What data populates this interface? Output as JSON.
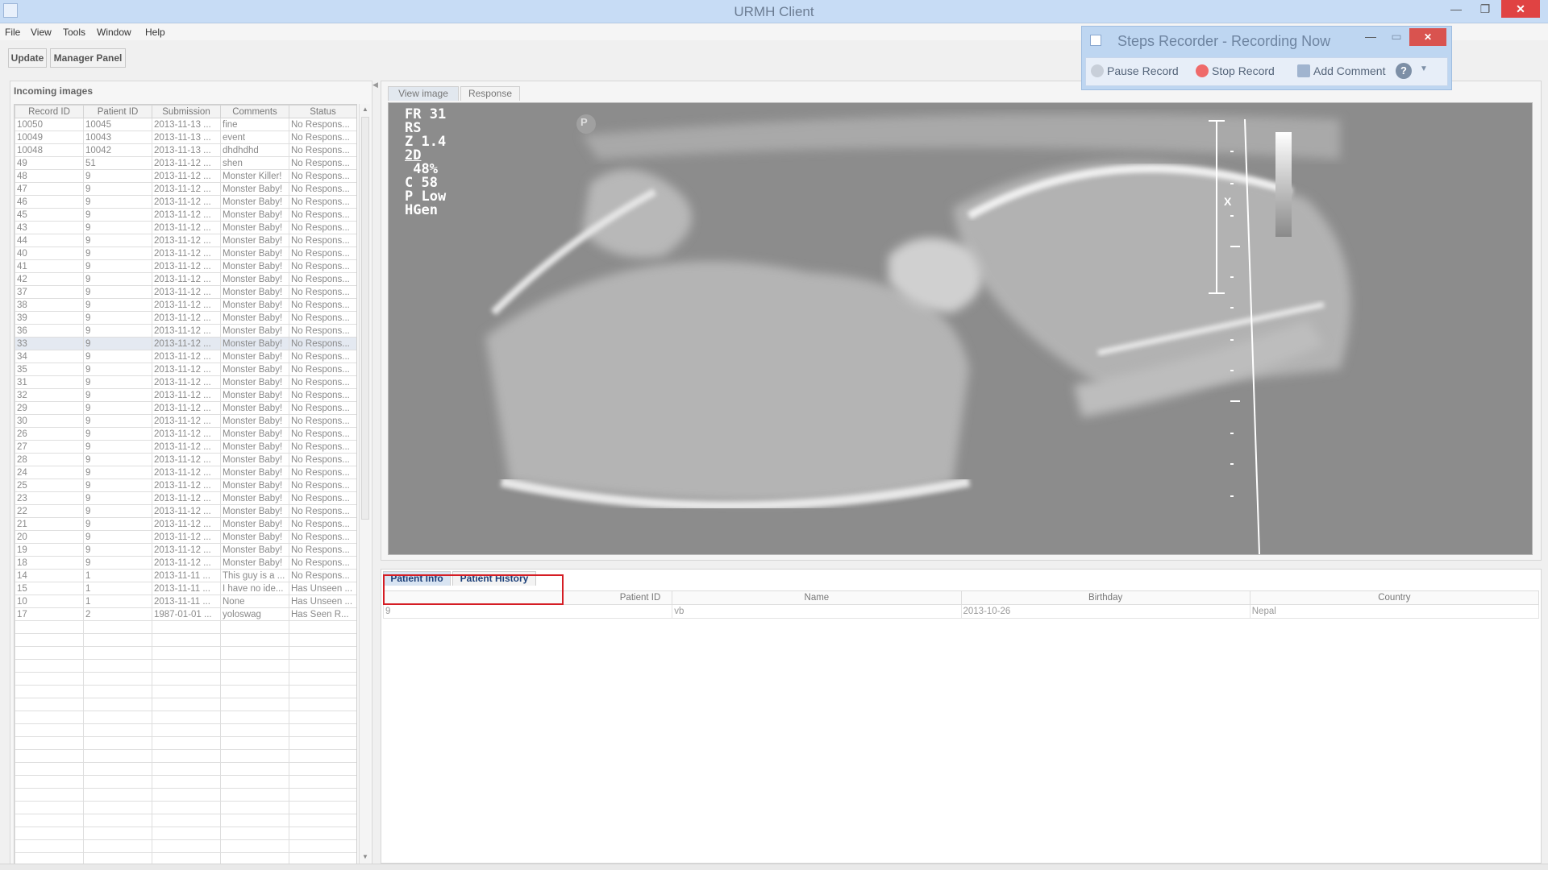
{
  "window": {
    "title": "URMH Client",
    "minimize": "—",
    "maximize": "❐",
    "close": "✕"
  },
  "menu": [
    {
      "label": "File"
    },
    {
      "label": "View"
    },
    {
      "label": "Tools"
    },
    {
      "label": "Window"
    },
    {
      "label": "Help"
    }
  ],
  "toolbar": {
    "update_label": "Update",
    "manager_label": "Manager Panel"
  },
  "incoming": {
    "header": "Incoming images",
    "columns": [
      "Record ID",
      "Patient ID",
      "Submission",
      "Comments",
      "Status"
    ],
    "rows": [
      [
        "10050",
        "10045",
        "2013-11-13 ...",
        "fine",
        "No Respons..."
      ],
      [
        "10049",
        "10043",
        "2013-11-13 ...",
        "event",
        "No Respons..."
      ],
      [
        "10048",
        "10042",
        "2013-11-13 ...",
        "dhdhdhd",
        "No Respons..."
      ],
      [
        "49",
        "51",
        "2013-11-12 ...",
        "shen",
        "No Respons..."
      ],
      [
        "48",
        "9",
        "2013-11-12 ...",
        "Monster Killer!",
        "No Respons..."
      ],
      [
        "47",
        "9",
        "2013-11-12 ...",
        "Monster Baby!",
        "No Respons..."
      ],
      [
        "46",
        "9",
        "2013-11-12 ...",
        "Monster Baby!",
        "No Respons..."
      ],
      [
        "45",
        "9",
        "2013-11-12 ...",
        "Monster Baby!",
        "No Respons..."
      ],
      [
        "43",
        "9",
        "2013-11-12 ...",
        "Monster Baby!",
        "No Respons..."
      ],
      [
        "44",
        "9",
        "2013-11-12 ...",
        "Monster Baby!",
        "No Respons..."
      ],
      [
        "40",
        "9",
        "2013-11-12 ...",
        "Monster Baby!",
        "No Respons..."
      ],
      [
        "41",
        "9",
        "2013-11-12 ...",
        "Monster Baby!",
        "No Respons..."
      ],
      [
        "42",
        "9",
        "2013-11-12 ...",
        "Monster Baby!",
        "No Respons..."
      ],
      [
        "37",
        "9",
        "2013-11-12 ...",
        "Monster Baby!",
        "No Respons..."
      ],
      [
        "38",
        "9",
        "2013-11-12 ...",
        "Monster Baby!",
        "No Respons..."
      ],
      [
        "39",
        "9",
        "2013-11-12 ...",
        "Monster Baby!",
        "No Respons..."
      ],
      [
        "36",
        "9",
        "2013-11-12 ...",
        "Monster Baby!",
        "No Respons..."
      ],
      [
        "33",
        "9",
        "2013-11-12 ...",
        "Monster Baby!",
        "No Respons..."
      ],
      [
        "34",
        "9",
        "2013-11-12 ...",
        "Monster Baby!",
        "No Respons..."
      ],
      [
        "35",
        "9",
        "2013-11-12 ...",
        "Monster Baby!",
        "No Respons..."
      ],
      [
        "31",
        "9",
        "2013-11-12 ...",
        "Monster Baby!",
        "No Respons..."
      ],
      [
        "32",
        "9",
        "2013-11-12 ...",
        "Monster Baby!",
        "No Respons..."
      ],
      [
        "29",
        "9",
        "2013-11-12 ...",
        "Monster Baby!",
        "No Respons..."
      ],
      [
        "30",
        "9",
        "2013-11-12 ...",
        "Monster Baby!",
        "No Respons..."
      ],
      [
        "26",
        "9",
        "2013-11-12 ...",
        "Monster Baby!",
        "No Respons..."
      ],
      [
        "27",
        "9",
        "2013-11-12 ...",
        "Monster Baby!",
        "No Respons..."
      ],
      [
        "28",
        "9",
        "2013-11-12 ...",
        "Monster Baby!",
        "No Respons..."
      ],
      [
        "24",
        "9",
        "2013-11-12 ...",
        "Monster Baby!",
        "No Respons..."
      ],
      [
        "25",
        "9",
        "2013-11-12 ...",
        "Monster Baby!",
        "No Respons..."
      ],
      [
        "23",
        "9",
        "2013-11-12 ...",
        "Monster Baby!",
        "No Respons..."
      ],
      [
        "22",
        "9",
        "2013-11-12 ...",
        "Monster Baby!",
        "No Respons..."
      ],
      [
        "21",
        "9",
        "2013-11-12 ...",
        "Monster Baby!",
        "No Respons..."
      ],
      [
        "20",
        "9",
        "2013-11-12 ...",
        "Monster Baby!",
        "No Respons..."
      ],
      [
        "19",
        "9",
        "2013-11-12 ...",
        "Monster Baby!",
        "No Respons..."
      ],
      [
        "18",
        "9",
        "2013-11-12 ...",
        "Monster Baby!",
        "No Respons..."
      ],
      [
        "14",
        "1",
        "2013-11-11 ...",
        "This guy is a ...",
        "No Respons..."
      ],
      [
        "15",
        "1",
        "2013-11-11 ...",
        "I have no ide...",
        "Has Unseen ..."
      ],
      [
        "10",
        "1",
        "2013-11-11 ...",
        "None",
        "Has Unseen ..."
      ],
      [
        "17",
        "2",
        "1987-01-01 ...",
        "yoloswag",
        "Has Seen R..."
      ]
    ],
    "selected_row": "33",
    "empty_rows": 19
  },
  "viewer": {
    "tabs": [
      "View image",
      "Response"
    ],
    "active_tab": "View image",
    "overlay": [
      "FR 31",
      "RS",
      "Z 1.4",
      "2D",
      " 48%",
      "C 58",
      "P Low",
      "HGen"
    ],
    "probe_mark": "P",
    "scale_mark": "X"
  },
  "patient": {
    "tabs": [
      "Patient Info",
      "Patient History"
    ],
    "active_tab": "Patient Info",
    "columns": [
      "Patient ID",
      "Name",
      "Birthday",
      "Country"
    ],
    "row": [
      "9",
      "vb",
      "2013-10-26",
      "Nepal"
    ]
  },
  "steps_recorder": {
    "title": "Steps Recorder - Recording Now",
    "pause_label": "Pause Record",
    "stop_label": "Stop Record",
    "comment_label": "Add Comment",
    "help": "?",
    "help_dropdown": "▼"
  },
  "colors": {
    "highlight": "#d51d24",
    "titlebar": "#c7dcf5",
    "selected_row": "#e4e9f1"
  }
}
